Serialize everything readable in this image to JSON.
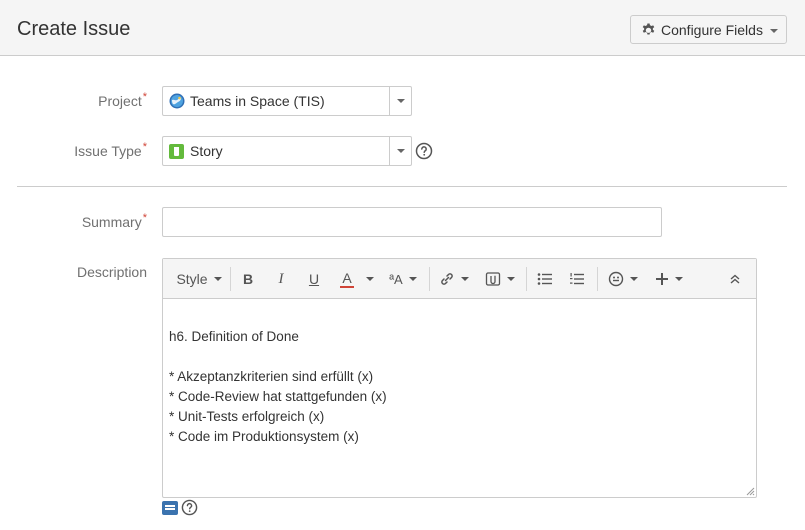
{
  "header": {
    "title": "Create Issue",
    "configure_label": "Configure Fields"
  },
  "form": {
    "project": {
      "label": "Project",
      "required_mark": "*",
      "value": "Teams in Space (TIS)"
    },
    "issue_type": {
      "label": "Issue Type",
      "required_mark": "*",
      "value": "Story"
    },
    "summary": {
      "label": "Summary",
      "required_mark": "*",
      "value": "",
      "placeholder": ""
    },
    "description": {
      "label": "Description",
      "toolbar": {
        "style_label": "Style",
        "bold": "B",
        "italic": "I",
        "underline": "U",
        "text_color": "A",
        "text_effects": "ªA"
      },
      "lines": [
        "",
        "h6. Definition of Done",
        "",
        "* Akzeptanzkriterien sind erfüllt (x)",
        "* Code-Review hat stattgefunden (x)",
        "* Unit-Tests erfolgreich (x)",
        "* Code im Produktionsystem (x)"
      ]
    }
  },
  "colors": {
    "required": "#d04437",
    "story_icon": "#63ba3c",
    "text_color_underline": "#d04437",
    "mode_icon": "#3b73af"
  },
  "icons": {
    "configure": "gear-icon",
    "project": "project-avatar-icon",
    "issue_type": "story-icon",
    "help": "help-icon"
  }
}
